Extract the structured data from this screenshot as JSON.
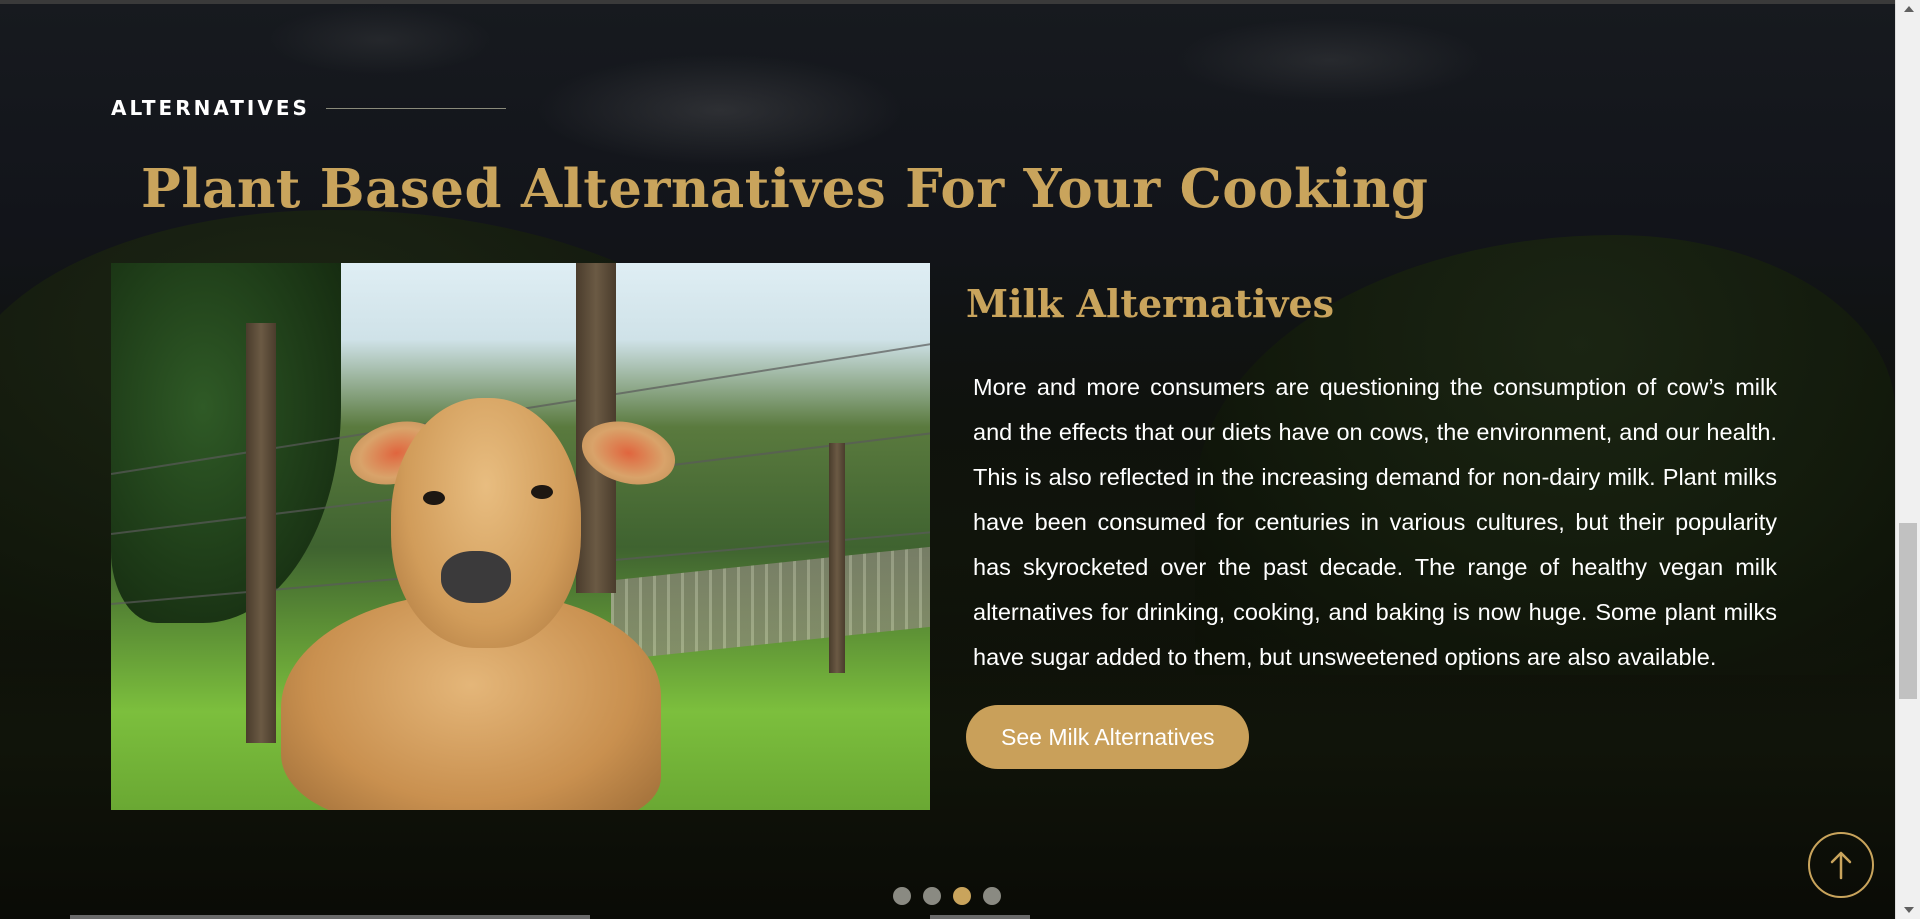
{
  "section": {
    "eyebrow": "ALTERNATIVES",
    "title": "Plant Based Alternatives For Your Cooking"
  },
  "slide": {
    "image_alt": "Calf lying in a grassy field",
    "title": "Milk Alternatives",
    "body": "More and more consumers are questioning the consumption of cow’s milk and the effects that our diets have on cows, the environment, and our health. This is also reflected in the increasing demand for non-dairy milk. Plant milks have been consumed for centuries in various cultures, but their popularity has skyrocketed over the past decade. The range of healthy vegan milk alternatives for drinking, cooking, and baking is now huge. Some plant milks have sugar added to them, but unsweetened options are also available.",
    "cta_label": "See Milk Alternatives"
  },
  "carousel": {
    "slide_count": 4,
    "active_index": 2
  },
  "back_to_top": {
    "icon": "arrow-up-icon"
  },
  "colors": {
    "accent": "#c9a45c",
    "button": "#c9a05a",
    "text": "#ffffff"
  }
}
